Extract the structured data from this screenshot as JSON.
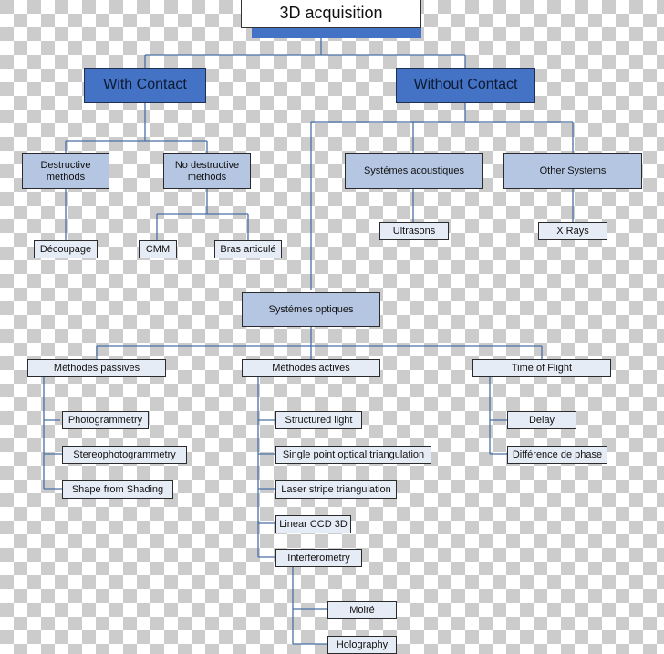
{
  "colors": {
    "level1_fill": "#4472c4",
    "level2_fill": "#b4c6e2",
    "leaf_fill": "#e6ecf6",
    "connector": "#4a6fa5"
  },
  "root": {
    "label": "3D acquisition"
  },
  "with_contact": {
    "label": "With Contact",
    "destructive": {
      "label": "Destructive methods",
      "children": [
        "Découpage"
      ]
    },
    "non_destructive": {
      "label": "No destructive methods",
      "children": [
        "CMM",
        "Bras articulé"
      ]
    }
  },
  "without_contact": {
    "label": "Without Contact",
    "acoustic": {
      "label": "Systémes acoustiques",
      "children": [
        "Ultrasons"
      ]
    },
    "other": {
      "label": "Other Systems",
      "children": [
        "X Rays"
      ]
    },
    "optical": {
      "label": "Systémes optiques",
      "passive": {
        "label": "Méthodes passives",
        "children": [
          "Photogrammetry",
          "Stereophotogrammetry",
          "Shape from Shading"
        ]
      },
      "active": {
        "label": "Méthodes actives",
        "children": [
          "Structured light",
          "Single point optical triangulation",
          "Laser stripe triangulation",
          "Linear CCD 3D",
          "Interferometry"
        ],
        "interferometry_children": [
          "Moiré",
          "Holography"
        ]
      },
      "tof": {
        "label": "Time of Flight",
        "children": [
          "Delay",
          "Différence de phase"
        ]
      }
    }
  }
}
